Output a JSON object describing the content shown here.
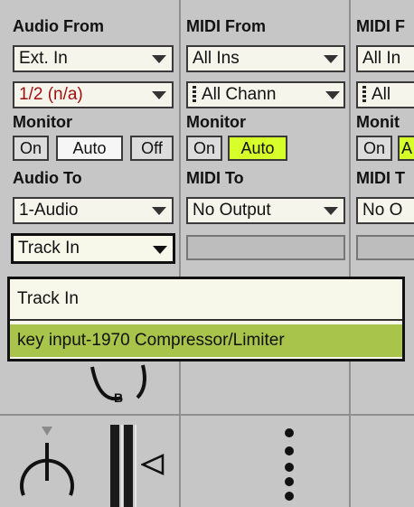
{
  "tracks": [
    {
      "from_header": "Audio From",
      "from_value": "Ext. In",
      "channel_value": "1/2 (n/a)",
      "monitor_label": "Monitor",
      "monitor_buttons": [
        "On",
        "Auto",
        "Off"
      ],
      "to_header": "Audio To",
      "to_value": "1-Audio",
      "input_value": "Track In"
    },
    {
      "from_header": "MIDI From",
      "from_value": "All Ins",
      "channel_value": "All Chann",
      "monitor_label": "Monitor",
      "monitor_buttons": [
        "On",
        "Auto"
      ],
      "to_header": "MIDI To",
      "to_value": "No Output"
    },
    {
      "from_header": "MIDI F",
      "from_value": "All In",
      "channel_value": "All",
      "monitor_label": "Monit",
      "monitor_buttons": [
        "On",
        "A"
      ],
      "to_header": "MIDI T",
      "to_value": "No O"
    }
  ],
  "popup": {
    "options": [
      "Track In",
      "key input-1970 Compressor/Limiter"
    ],
    "selected_index": 1
  },
  "knob_letter": "B",
  "colors": {
    "monitor_on": "#d7ff2a",
    "popup_selected": "#a8c44a",
    "panel": "#c6c6c6"
  }
}
